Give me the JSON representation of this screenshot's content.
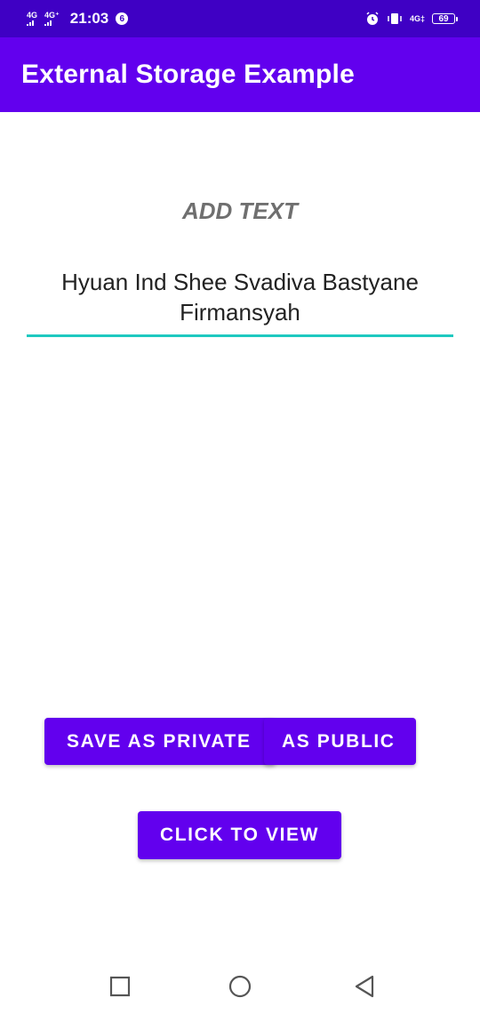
{
  "status_bar": {
    "network1": "4G",
    "network2": "4G⁺",
    "time": "21:03",
    "notification_count": "6",
    "network3": "4G‡",
    "battery": "69"
  },
  "app_bar": {
    "title": "External Storage Example"
  },
  "main": {
    "heading": "ADD TEXT",
    "input_value": "Hyuan Ind Shee Svadiva Bastyane Firmansyah"
  },
  "buttons": {
    "save_private": "SAVE AS PRIVATE",
    "save_public": "AS PUBLIC",
    "view": "CLICK TO VIEW"
  },
  "colors": {
    "status_bar": "#3f00c4",
    "primary": "#6200ee",
    "accent": "#1ec9c0"
  },
  "nav_icons": [
    "recent-apps-icon",
    "home-icon",
    "back-icon"
  ]
}
